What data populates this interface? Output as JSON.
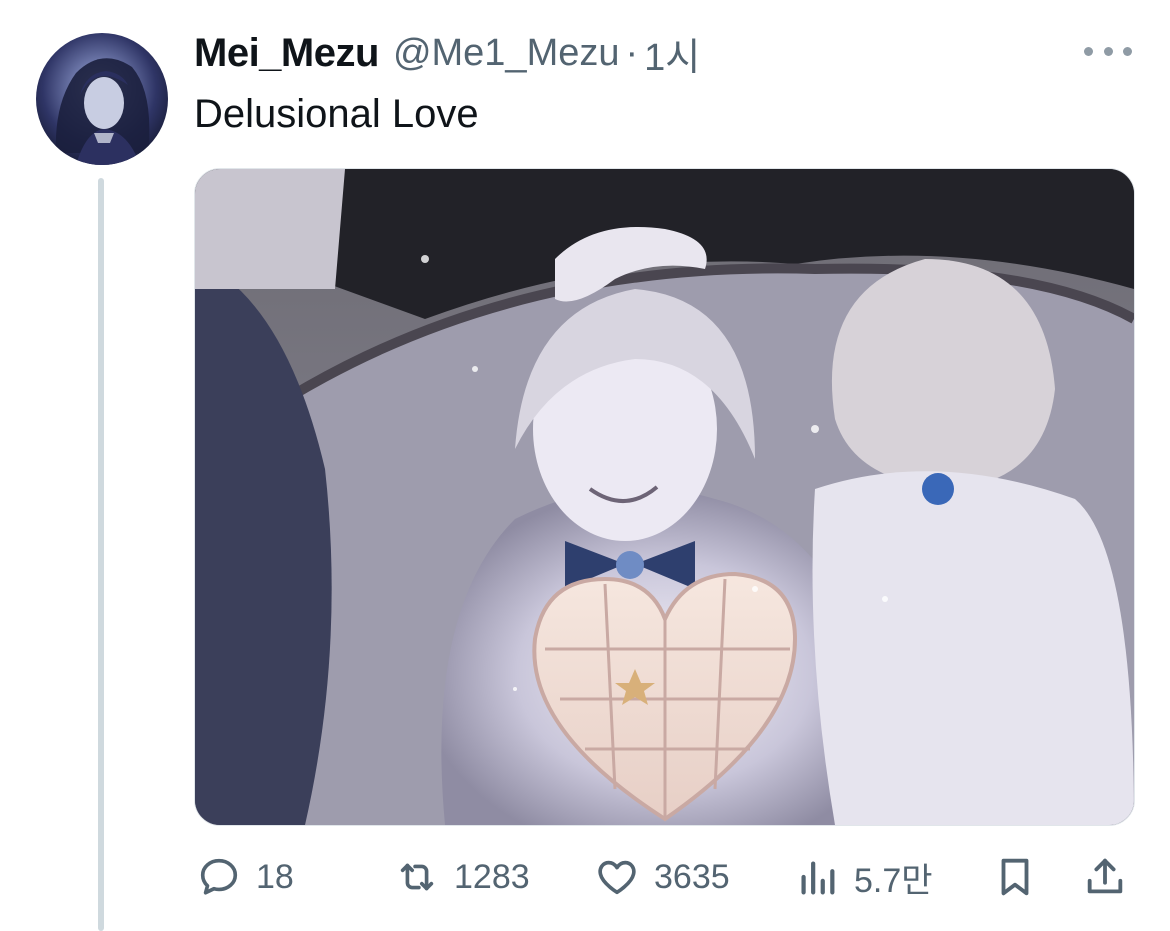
{
  "post": {
    "display_name": "Mei_Mezu",
    "handle": "@Me1_Mezu",
    "separator": "·",
    "time": "1시",
    "text": "Delusional Love"
  },
  "media": {
    "icon": "artwork-image"
  },
  "actions": {
    "replies": "18",
    "reposts": "1283",
    "likes": "3635",
    "views": "5.7만"
  },
  "colors": {
    "text": "#0f1419",
    "secondary": "#536471",
    "thread_line": "#cfd9de"
  }
}
